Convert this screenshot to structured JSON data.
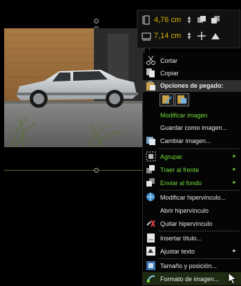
{
  "toolbar": {
    "height_value": "4,76 cm",
    "width_value": "7,14 cm"
  },
  "menu": {
    "cut": "Cortar",
    "copy": "Copiar",
    "paste_options": "Opciones de pegado:",
    "edit_image": "Modificar imagen",
    "save_as_image": "Guardar como imagen...",
    "change_image": "Cambiar imagen...",
    "group": "Agrupar",
    "bring_to_front": "Traer al frente",
    "send_to_back": "Enviar al fondo",
    "edit_hyperlink": "Modificar hipervínculo...",
    "open_hyperlink": "Abrir hipervínculo",
    "remove_hyperlink": "Quitar hipervínculo",
    "insert_caption": "Insertar título...",
    "wrap_text": "Ajustar texto",
    "size_position": "Tamaño y posición...",
    "format_image": "Formato de imagen..."
  },
  "colors": {
    "accent_green": "#6fdc3c",
    "value_yellow": "#d6b400"
  }
}
